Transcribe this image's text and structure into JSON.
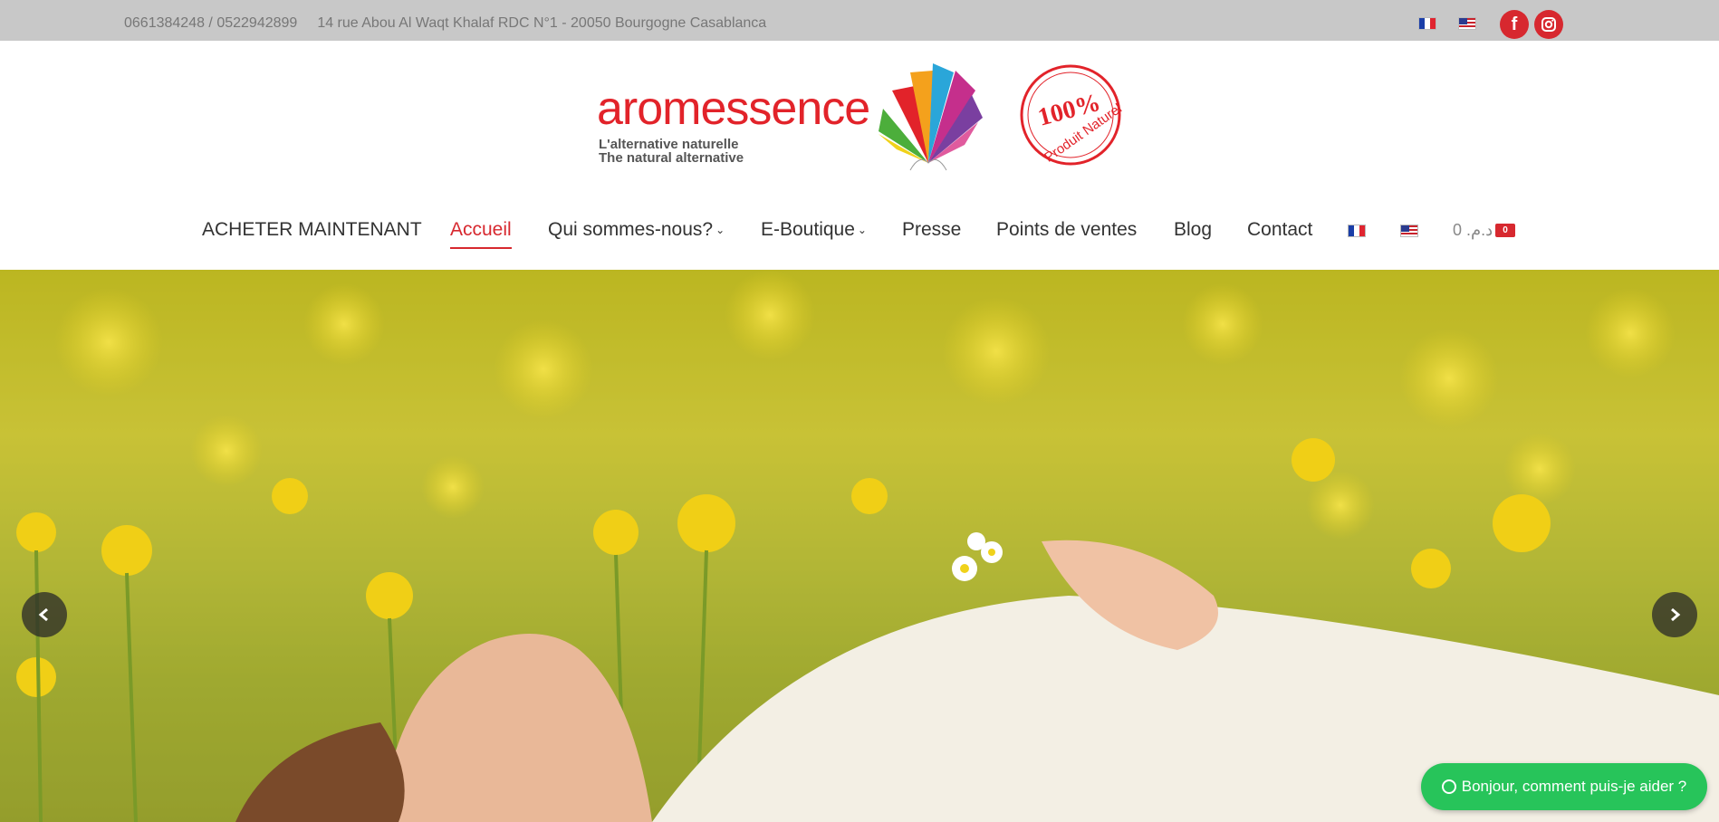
{
  "topbar": {
    "phones": "0661384248 / 0522942899",
    "address": "14 rue Abou Al Waqt Khalaf RDC N°1 - 20050 Bourgogne Casablanca",
    "flags": [
      "flag-fr-icon",
      "flag-us-icon"
    ],
    "social": [
      "facebook-icon",
      "instagram-icon"
    ]
  },
  "logo": {
    "wordmark": "aromessence",
    "tagline_fr": "L'alternative naturelle",
    "tagline_en": "The natural alternative",
    "seal_percent": "100%",
    "seal_text": "Produit Naturel"
  },
  "nav": {
    "items": [
      {
        "label": "ACHETER MAINTENANT"
      },
      {
        "label": "Accueil",
        "active": true
      },
      {
        "label": "Qui sommes-nous?",
        "dropdown": true
      },
      {
        "label": "E-Boutique",
        "dropdown": true
      },
      {
        "label": "Presse"
      },
      {
        "label": "Points de ventes"
      },
      {
        "label": "Blog"
      },
      {
        "label": "Contact"
      }
    ],
    "cart_amount": "د.م. 0",
    "cart_count": "0"
  },
  "hero": {
    "prev_icon": "chevron-left-icon",
    "next_icon": "chevron-right-icon"
  },
  "whatsapp": {
    "label": "Bonjour, comment puis-je aider ?"
  },
  "colors": {
    "accent": "#d7282f",
    "topbar_bg": "#c8c8c8",
    "whatsapp_green": "#27c45a"
  }
}
